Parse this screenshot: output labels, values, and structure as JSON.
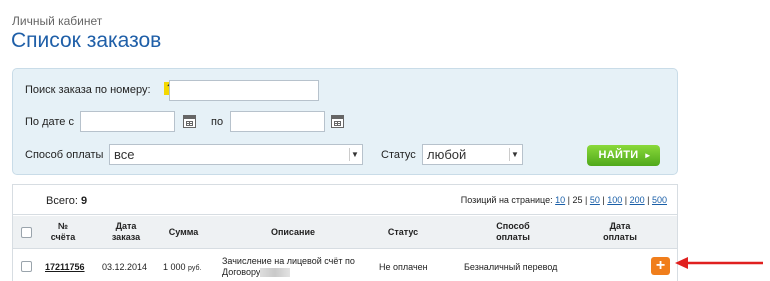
{
  "header": {
    "breadcrumb": "Личный кабинет",
    "title": "Список заказов"
  },
  "filter": {
    "search_label": "Поиск заказа по номеру:",
    "help_icon": "?",
    "date_from_label": "По дате с",
    "date_to_label": "по",
    "payment_label": "Способ оплаты",
    "payment_value": "все",
    "status_label": "Статус",
    "status_value": "любой",
    "find_button": "НАЙТИ",
    "find_button_icon": "►"
  },
  "table": {
    "total_label": "Всего:",
    "total_value": "9",
    "per_page_label": "Позиций на странице:",
    "per_page_options": [
      "10",
      "25",
      "50",
      "100",
      "200",
      "500"
    ],
    "per_page_selected": "25",
    "columns": {
      "number": [
        "№",
        "счёта"
      ],
      "date": [
        "Дата",
        "заказа"
      ],
      "sum": "Сумма",
      "description": "Описание",
      "status": "Статус",
      "payment": [
        "Способ",
        "оплаты"
      ],
      "pay_date": [
        "Дата",
        "оплаты"
      ]
    },
    "rows": [
      {
        "number": "17211756",
        "date": "03.12.2014",
        "sum": "1 000",
        "currency": "руб.",
        "description_line1": "Зачисление на лицевой счёт по",
        "description_line2": "Договору",
        "status": "Не оплачен",
        "payment": "Безналичный перевод",
        "action_icon": "+"
      }
    ]
  },
  "colors": {
    "title": "#1f5fa8",
    "find_button": "#5cb82a",
    "plus_button": "#f07e1c",
    "arrow": "#e0201f"
  }
}
